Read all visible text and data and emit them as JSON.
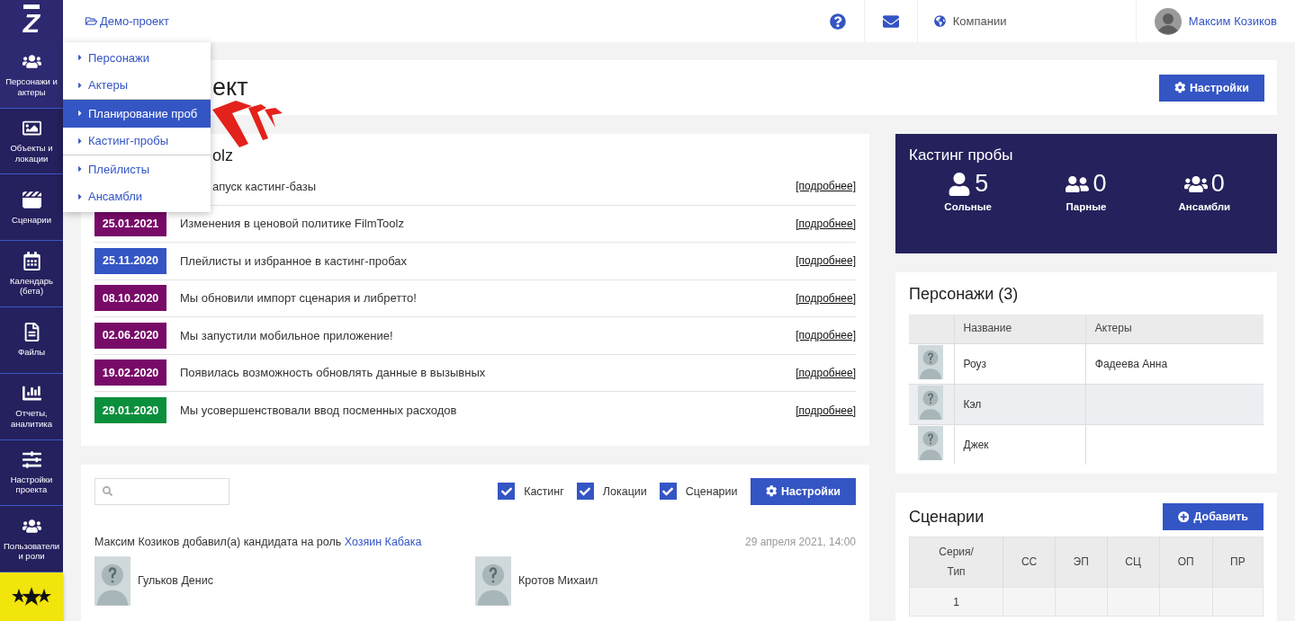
{
  "topbar": {
    "logo": "Z",
    "project": "Демо-проект",
    "companies": "Компании",
    "user": "Максим Козиков"
  },
  "sidebar": {
    "items": [
      {
        "label": "Персонажи и актеры",
        "kind": "users",
        "selected": true
      },
      {
        "label": "Объекты и локации",
        "kind": "image",
        "selected": false
      },
      {
        "label": "Сценарии",
        "kind": "film",
        "selected": false
      },
      {
        "label": "Календарь (бета)",
        "kind": "calendar",
        "selected": false
      },
      {
        "label": "Файлы",
        "kind": "file",
        "selected": false
      },
      {
        "label": "Отчеты, аналитика",
        "kind": "chart",
        "selected": false
      },
      {
        "label": "Настройки проекта",
        "kind": "sliders",
        "selected": false
      },
      {
        "label": "Пользователи и роли",
        "kind": "users",
        "selected": false
      }
    ]
  },
  "project_menu": {
    "groups": [
      {
        "items": [
          {
            "label": "Персонажи",
            "selected": false
          },
          {
            "label": "Актеры",
            "selected": false
          }
        ]
      },
      {
        "items": [
          {
            "label": "Планирование проб",
            "selected": true
          },
          {
            "label": "Кастинг-пробы",
            "selected": false
          }
        ]
      },
      {
        "items": [
          {
            "label": "Плейлисты",
            "selected": false
          },
          {
            "label": "Ансамбли",
            "selected": false
          }
        ]
      }
    ]
  },
  "page": {
    "title": "ект",
    "settings_button": "Настройки"
  },
  "news": {
    "title": "olz",
    "rows": [
      {
        "text": "апуск кастинг-базы",
        "more": "[подробнее]"
      },
      {
        "date": "25.01.2021",
        "color": "#780a68",
        "text": "Изменения в ценовой политике FilmToolz",
        "more": "[подробнее]"
      },
      {
        "date": "25.11.2020",
        "color": "#3455c4",
        "text": "Плейлисты и избранное в кастинг-пробах",
        "more": "[подробнее]"
      },
      {
        "date": "08.10.2020",
        "color": "#780a68",
        "text": "Мы обновили импорт сценария и либретто!",
        "more": "[подробнее]"
      },
      {
        "date": "02.06.2020",
        "color": "#780a68",
        "text": "Мы запустили мобильное приложение!",
        "more": "[подробнее]"
      },
      {
        "date": "19.02.2020",
        "color": "#780a68",
        "text": "Появилась возможность обновлять данные в вызывных",
        "more": "[подробнее]"
      },
      {
        "date": "29.01.2020",
        "color": "#0b8f3c",
        "text": "Мы усовершенствовали ввод посменных расходов",
        "more": "[подробнее]"
      }
    ]
  },
  "activity": {
    "filters": [
      {
        "label": "Кастинг",
        "checked": true
      },
      {
        "label": "Локации",
        "checked": true
      },
      {
        "label": "Сценарии",
        "checked": true
      }
    ],
    "settings_button": "Настройки",
    "entries": [
      {
        "text": "Максим Козиков добавил(а) кандидата на роль ",
        "role": "Хозяин Кабака",
        "time": "29 апреля 2021, 14:00",
        "candidates": [
          "Гульков Денис",
          "Кротов Михаил"
        ]
      }
    ]
  },
  "casting": {
    "title": "Кастинг пробы",
    "stats": [
      {
        "kind": "solo",
        "count": "5",
        "label": "Сольные"
      },
      {
        "kind": "pair",
        "count": "0",
        "label": "Парные"
      },
      {
        "kind": "group",
        "count": "0",
        "label": "Ансамбли"
      }
    ]
  },
  "characters": {
    "title": "Персонажи (3)",
    "columns": [
      "Название",
      "Актеры"
    ],
    "rows": [
      {
        "name": "Роуз",
        "actor": "Фадеева Анна",
        "highlighted": false
      },
      {
        "name": "Кэл",
        "highlighted": true
      },
      {
        "name": "Джек",
        "highlighted": false
      }
    ]
  },
  "scenarios": {
    "title": "Сценарии",
    "add_button": "Добавить",
    "columns": [
      "Серия/\nТип",
      "СС",
      "ЭП",
      "СЦ",
      "ОП",
      "ПР"
    ],
    "rows": [
      {
        "series": "1"
      }
    ]
  }
}
